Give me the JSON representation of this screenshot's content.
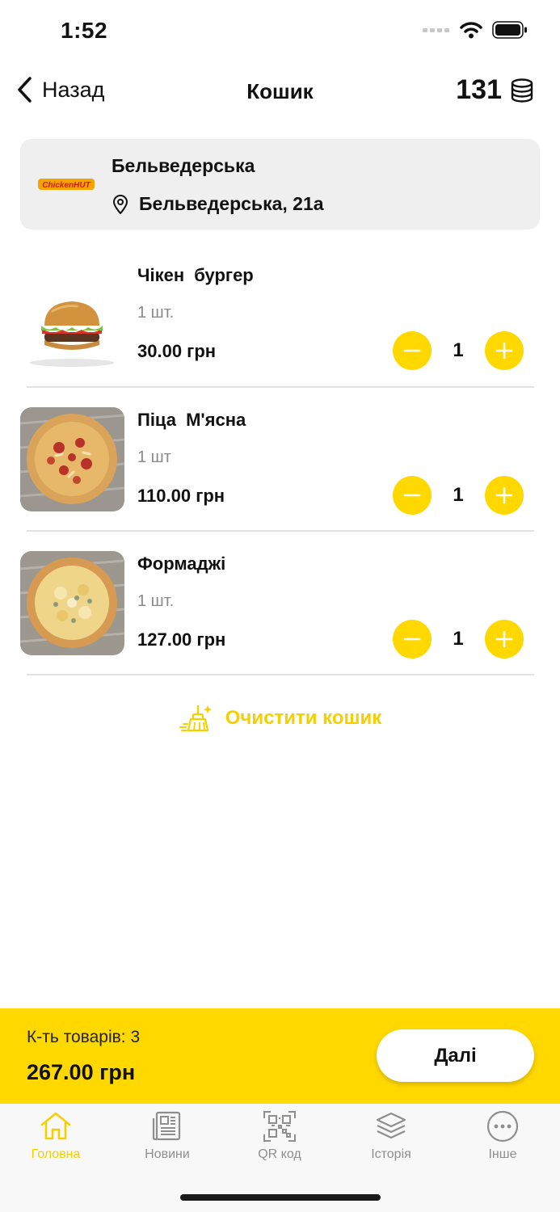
{
  "status": {
    "time": "1:52"
  },
  "nav": {
    "back_label": "Назад",
    "title": "Кошик",
    "points": "131"
  },
  "store": {
    "logo_text": "ChickenHUT",
    "name": "Бельведерська",
    "address": "Бельведерська, 21а"
  },
  "items": [
    {
      "name": "Чікен бургер",
      "qty_text": "1 шт.",
      "price": "30.00 грн",
      "quantity": "1",
      "image": "burger-image"
    },
    {
      "name": "Піца М'ясна",
      "qty_text": "1 шт",
      "price": "110.00 грн",
      "quantity": "1",
      "image": "meat-pizza-image"
    },
    {
      "name": "Формаджі",
      "qty_text": "1 шт.",
      "price": "127.00 грн",
      "quantity": "1",
      "image": "cheese-pizza-image"
    }
  ],
  "clear_label": "Очистити кошик",
  "summary": {
    "count_label": "К-ть товарів: 3",
    "total": "267.00 грн",
    "next_label": "Далі"
  },
  "tabs": [
    {
      "label": "Головна",
      "icon": "home-icon",
      "active": true
    },
    {
      "label": "Новини",
      "icon": "news-icon",
      "active": false
    },
    {
      "label": "QR код",
      "icon": "qr-code-icon",
      "active": false
    },
    {
      "label": "Історія",
      "icon": "layers-icon",
      "active": false
    },
    {
      "label": "Інше",
      "icon": "more-icon",
      "active": false
    }
  ],
  "colors": {
    "accent": "#ffd800",
    "accent_text": "#f5cf00",
    "card_bg": "#efefef"
  }
}
